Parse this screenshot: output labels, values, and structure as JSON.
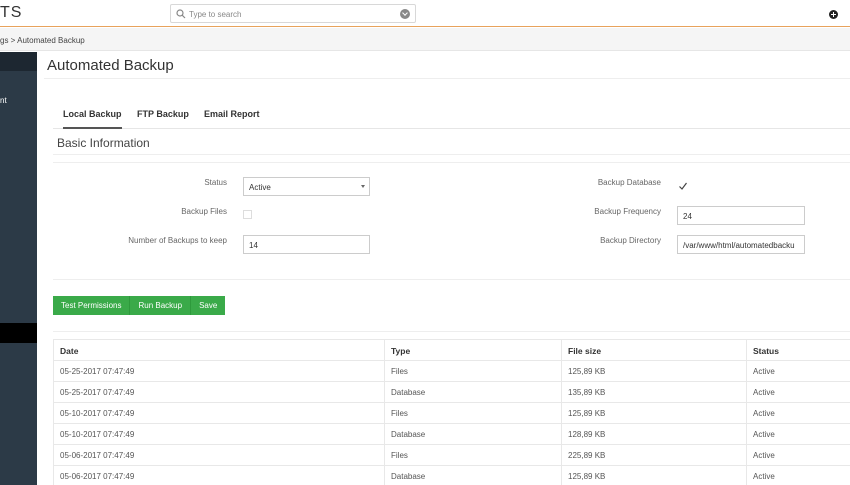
{
  "app": {
    "brand": "TS"
  },
  "search": {
    "placeholder": "Type to search"
  },
  "breadcrumb": "gs > Automated Backup",
  "sidebar": {
    "partial_label": "nt"
  },
  "page": {
    "title": "Automated Backup"
  },
  "tabs": [
    {
      "label": "Local Backup",
      "active": true
    },
    {
      "label": "FTP Backup",
      "active": false
    },
    {
      "label": "Email Report",
      "active": false
    }
  ],
  "section": {
    "title": "Basic Information"
  },
  "form": {
    "status_label": "Status",
    "status_value": "Active",
    "backup_files_label": "Backup Files",
    "backup_files_checked": false,
    "num_backups_label": "Number of Backups to keep",
    "num_backups_value": "14",
    "backup_database_label": "Backup Database",
    "backup_database_checked": true,
    "backup_frequency_label": "Backup Frequency",
    "backup_frequency_value": "24",
    "backup_directory_label": "Backup Directory",
    "backup_directory_value": "/var/www/html/automatedbacku"
  },
  "buttons": {
    "test_permissions": "Test Permissions",
    "run_backup": "Run Backup",
    "save": "Save"
  },
  "table": {
    "headers": [
      "Date",
      "Type",
      "File size",
      "Status"
    ],
    "rows": [
      [
        "05-25-2017 07:47:49",
        "Files",
        "125,89 KB",
        "Active"
      ],
      [
        "05-25-2017 07:47:49",
        "Database",
        "135,89 KB",
        "Active"
      ],
      [
        "05-10-2017 07:47:49",
        "Files",
        "125,89 KB",
        "Active"
      ],
      [
        "05-10-2017 07:47:49",
        "Database",
        "128,89 KB",
        "Active"
      ],
      [
        "05-06-2017 07:47:49",
        "Files",
        "225,89 KB",
        "Active"
      ],
      [
        "05-06-2017 07:47:49",
        "Database",
        "125,89 KB",
        "Active"
      ]
    ]
  },
  "colors": {
    "accent_green": "#3aaa49",
    "sidebar_bg": "#2c3a47",
    "topbar_border": "#e8a35c"
  },
  "icons": {
    "search": "search-icon",
    "dropdown": "chevron-down-icon",
    "add": "plus-icon",
    "check": "checkmark-icon"
  }
}
